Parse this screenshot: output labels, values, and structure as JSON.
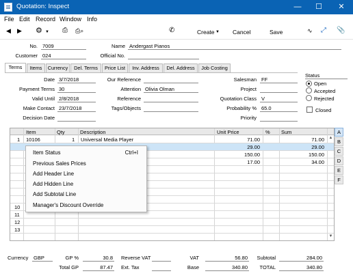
{
  "window": {
    "title": "Quotation: Inspect",
    "minimize": "—",
    "maximize": "☐",
    "close": "✕"
  },
  "menu": [
    "File",
    "Edit",
    "Record",
    "Window",
    "Info"
  ],
  "toolbar": {
    "create": "Create",
    "cancel": "Cancel",
    "save": "Save"
  },
  "header": {
    "no_label": "No.",
    "no": "7009",
    "name_label": "Name",
    "name": "Andergast Pianos",
    "customer_label": "Customer",
    "customer": "024",
    "official_label": "Official No.",
    "official": ""
  },
  "tabs": [
    "Terms",
    "Items",
    "Currency",
    "Del. Terms",
    "Price List",
    "Inv. Address",
    "Del. Address",
    "Job Costing"
  ],
  "terms": {
    "date_label": "Date",
    "date": "3/7/2018",
    "payment_label": "Payment Terms",
    "payment": "30",
    "valid_label": "Valid Until",
    "valid": "2/8/2018",
    "make_label": "Make Contact",
    "make": "23/7/2018",
    "decision_label": "Decision Date",
    "decision": "",
    "ourref_label": "Our Reference",
    "ourref": "",
    "attention_label": "Attention",
    "attention": "Olivia Olman",
    "reference_label": "Reference",
    "reference": "",
    "tags_label": "Tags/Objects",
    "tags": "",
    "salesman_label": "Salesman",
    "salesman": "FF",
    "project_label": "Project",
    "project": "",
    "qclass_label": "Quotation Class",
    "qclass": "V",
    "prob_label": "Probability %",
    "prob": "65.0",
    "priority_label": "Priority",
    "priority": ""
  },
  "status": {
    "label": "Status",
    "options": [
      "Open",
      "Accepted",
      "Rejected"
    ],
    "closed_label": "Closed"
  },
  "grid": {
    "headers": {
      "item": "Item",
      "qty": "Qty",
      "desc": "Description",
      "price": "Unit Price",
      "pct": "%",
      "sum": "Sum"
    },
    "rows": [
      {
        "n": "1",
        "item": "10106",
        "qty": "1",
        "desc": "Universal Media Player",
        "price": "71.00",
        "sum": "71.00"
      },
      {
        "n": "",
        "item": "",
        "qty": "",
        "desc": "",
        "price": "29.00",
        "sum": "29.00"
      },
      {
        "n": "",
        "item": "",
        "qty": "",
        "desc": "",
        "price": "150.00",
        "sum": "150.00"
      },
      {
        "n": "",
        "item": "",
        "qty": "",
        "desc": "",
        "price": "17.00",
        "sum": "34.00"
      },
      {
        "n": "",
        "item": "",
        "qty": "",
        "desc": "",
        "price": "",
        "sum": ""
      },
      {
        "n": "",
        "item": "",
        "qty": "",
        "desc": "",
        "price": "",
        "sum": ""
      },
      {
        "n": "",
        "item": "",
        "qty": "",
        "desc": "",
        "price": "",
        "sum": ""
      },
      {
        "n": "",
        "item": "",
        "qty": "",
        "desc": "",
        "price": "",
        "sum": ""
      },
      {
        "n": "",
        "item": "",
        "qty": "",
        "desc": "",
        "price": "",
        "sum": ""
      },
      {
        "n": "10",
        "item": "",
        "qty": "",
        "desc": "",
        "price": "",
        "sum": ""
      },
      {
        "n": "11",
        "item": "",
        "qty": "",
        "desc": "",
        "price": "",
        "sum": ""
      },
      {
        "n": "12",
        "item": "",
        "qty": "",
        "desc": "",
        "price": "",
        "sum": ""
      },
      {
        "n": "13",
        "item": "",
        "qty": "",
        "desc": "",
        "price": "",
        "sum": ""
      }
    ],
    "letters": [
      "A",
      "B",
      "C",
      "D",
      "E",
      "F"
    ]
  },
  "context_menu": {
    "items": [
      {
        "label": "Item Status",
        "shortcut": "Ctrl+I"
      },
      {
        "label": "Previous Sales Prices",
        "shortcut": ""
      },
      {
        "label": "Add Header Line",
        "shortcut": ""
      },
      {
        "label": "Add Hidden Line",
        "shortcut": ""
      },
      {
        "label": "Add Subtotal Line",
        "shortcut": ""
      },
      {
        "label": "Manager's Discount Override",
        "shortcut": ""
      }
    ]
  },
  "footer": {
    "currency_label": "Currency",
    "currency": "GBP",
    "gp_pct_label": "GP %",
    "gp_pct": "30.8",
    "total_gp_label": "Total GP",
    "total_gp": "87.47",
    "reverse_vat_label": "Reverse VAT",
    "reverse_vat": "",
    "ext_tax_label": "Ext. Tax",
    "ext_tax": "",
    "vat_label": "VAT",
    "vat": "56.80",
    "base_label": "Base",
    "base": "340.80",
    "subtotal_label": "Subtotal",
    "subtotal": "284.00",
    "total_label": "TOTAL",
    "total": "340.80"
  },
  "colors": {
    "titlebar": "#0a63b4",
    "selection": "#cde4f7"
  }
}
